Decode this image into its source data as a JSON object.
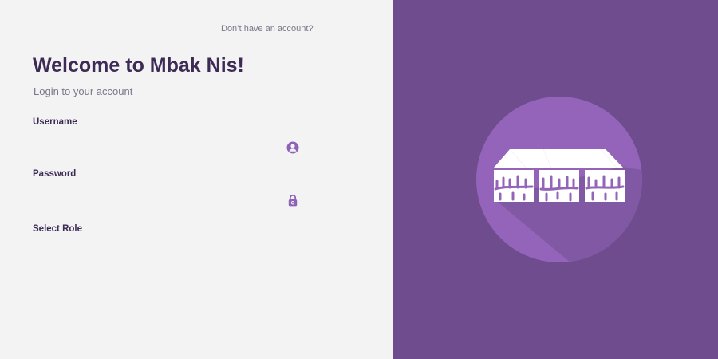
{
  "auth": {
    "signup_prompt": "Don’t have an account?"
  },
  "login": {
    "title": "Welcome to Mbak Nis!",
    "subtitle": "Login to your account",
    "username_label": "Username",
    "username_value": "",
    "password_label": "Password",
    "password_value": "",
    "role_label": "Select Role"
  },
  "icons": {
    "username": "user-circle-icon",
    "password": "lock-icon",
    "emblem": "market-stall-logo"
  },
  "colors": {
    "accent": "#8e62b8",
    "brand_panel": "#6e4c8d",
    "emblem_circle": "#9364b9",
    "heading": "#3d2b56",
    "muted_text": "#7c7689",
    "page_background": "#f3f3f3"
  }
}
